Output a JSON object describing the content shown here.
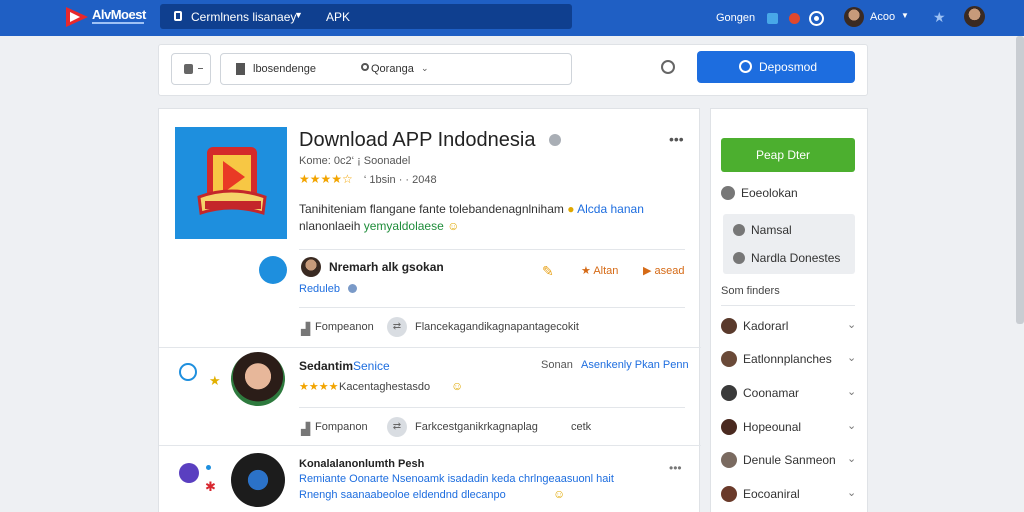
{
  "topbar": {
    "brand": "AlvMoest",
    "search_text": "Cermlnens lisanaey",
    "search_tag": "APK",
    "user_label": "Gongen",
    "account_name": "Acoo"
  },
  "filter": {
    "category": "lbosendenge",
    "location": "Qoranga",
    "search_button": "Deposmod"
  },
  "app": {
    "title": "Download APP Indodnesia",
    "meta": "Kome: 0c2‘ ¡ Soonadel",
    "rating_text": "‘ 1bsin · · 2048",
    "rating_value": 4,
    "desc_line1": "Tanihiteniam flangane fante tolebandenagnlniham",
    "desc_line1_link": "Alcda hanan",
    "desc_line2_plain": "nlanonlaeih",
    "desc_line2_green": "yemyaldolaese",
    "author_name": "Nremarh alk gsokan",
    "author_sub": "Reduleb",
    "action_alter": "Altan",
    "action_saved": "asead",
    "comparison_label": "Fompeanon",
    "comparison_text": "Flancekagandikagnapantagecokit"
  },
  "review1": {
    "name": "Sedantim",
    "name_link": "Senice",
    "right_label": "Sonan",
    "right_link": "Asenkenly Pkan Penn",
    "stars_text": "Kacentaghestasdo",
    "compare_label": "Fompanon",
    "compare_text": "Farkcestganikrkagnaplag",
    "compare_tail": "cetk"
  },
  "review2": {
    "title": "Konalalanonlumth Pesh",
    "line1": "Remiante Oonarte Nsenoamk isadadin keda chrlngeaasuonl hait",
    "line2": "Rnengh saanaabeoloe eldendnd dlecanpo"
  },
  "sidebar": {
    "primary_button": "Peap Dter",
    "bookmark_label": "Eoeolokan",
    "option_normal": "Namsal",
    "option_details": "Nardla Donestes",
    "section_title": "Som finders",
    "items": [
      "Kadorarl",
      "Eatlonnplanches",
      "Coonamar",
      "Hopeounal",
      "Denule Sanmeon",
      "Eocoaniral"
    ]
  },
  "colors": {
    "topbar": "#1f5fc4",
    "primary": "#1d6ddf",
    "success": "#4caf2f",
    "star": "#f2a400"
  }
}
